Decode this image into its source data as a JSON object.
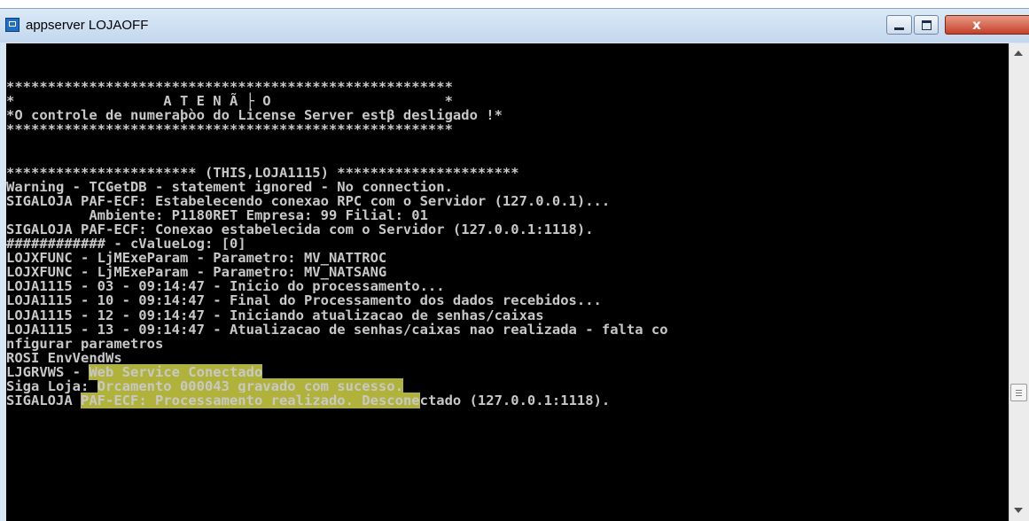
{
  "window": {
    "title": "appserver LOJAOFF",
    "icon": "console-app-icon",
    "controls": {
      "minimize_icon": "minimize-icon",
      "maximize_icon": "maximize-icon",
      "close_symbol": "x"
    }
  },
  "console": {
    "background": "#000000",
    "text_color": "#c8c8c8",
    "highlight_color": "#b0b23a",
    "lines": [
      "******************************************************",
      "*                  A T E N Ã ├ O                     *",
      "*O controle de numeraþòo do License Server estβ desligado !*",
      "******************************************************",
      "",
      "",
      "*********************** (THIS,LOJA1115) **********************",
      "Warning - TCGetDB - statement ignored - No connection.",
      "SIGALOJA PAF-ECF: Estabelecendo conexao RPC com o Servidor (127.0.0.1)...",
      "          Ambiente: P1180RET Empresa: 99 Filial: 01",
      "SIGALOJA PAF-ECF: Conexao estabelecida com o Servidor (127.0.0.1:1118).",
      "############ - cValueLog: [0]",
      "LOJXFUNC - LjMExeParam - Parametro: MV_NATTROC",
      "LOJXFUNC - LjMExeParam - Parametro: MV_NATSANG",
      "LOJA1115 - 03 - 09:14:47 - Inicio do processamento...",
      "LOJA1115 - 10 - 09:14:47 - Final do Processamento dos dados recebidos...",
      "LOJA1115 - 12 - 09:14:47 - Iniciando atualizacao de senhas/caixas",
      "LOJA1115 - 13 - 09:14:47 - Atualizacao de senhas/caixas nao realizada - falta co",
      "nfigurar parametros",
      "ROSI EnvVendWs",
      "LJGRVWS - Web Service Conectado",
      "Siga Loja: Orcamento 000043 gravado com sucesso.",
      "SIGALOJA PAF-ECF: Processamento realizado. Desconectado (127.0.0.1:1118)."
    ],
    "highlight_parts": {
      "line20_pre": "LJGRVWS - ",
      "line20_hl": "Web Service Conectado",
      "line21_pre": "Siga Loja: ",
      "line21_hl": "Orcamento 000043 gravado com sucesso.",
      "line22_pre": "SIGALOJA ",
      "line22_hl": "PAF-ECF: Processamento realizado. Descone",
      "line22_post": "ctado (127.0.0.1:1118)."
    }
  }
}
